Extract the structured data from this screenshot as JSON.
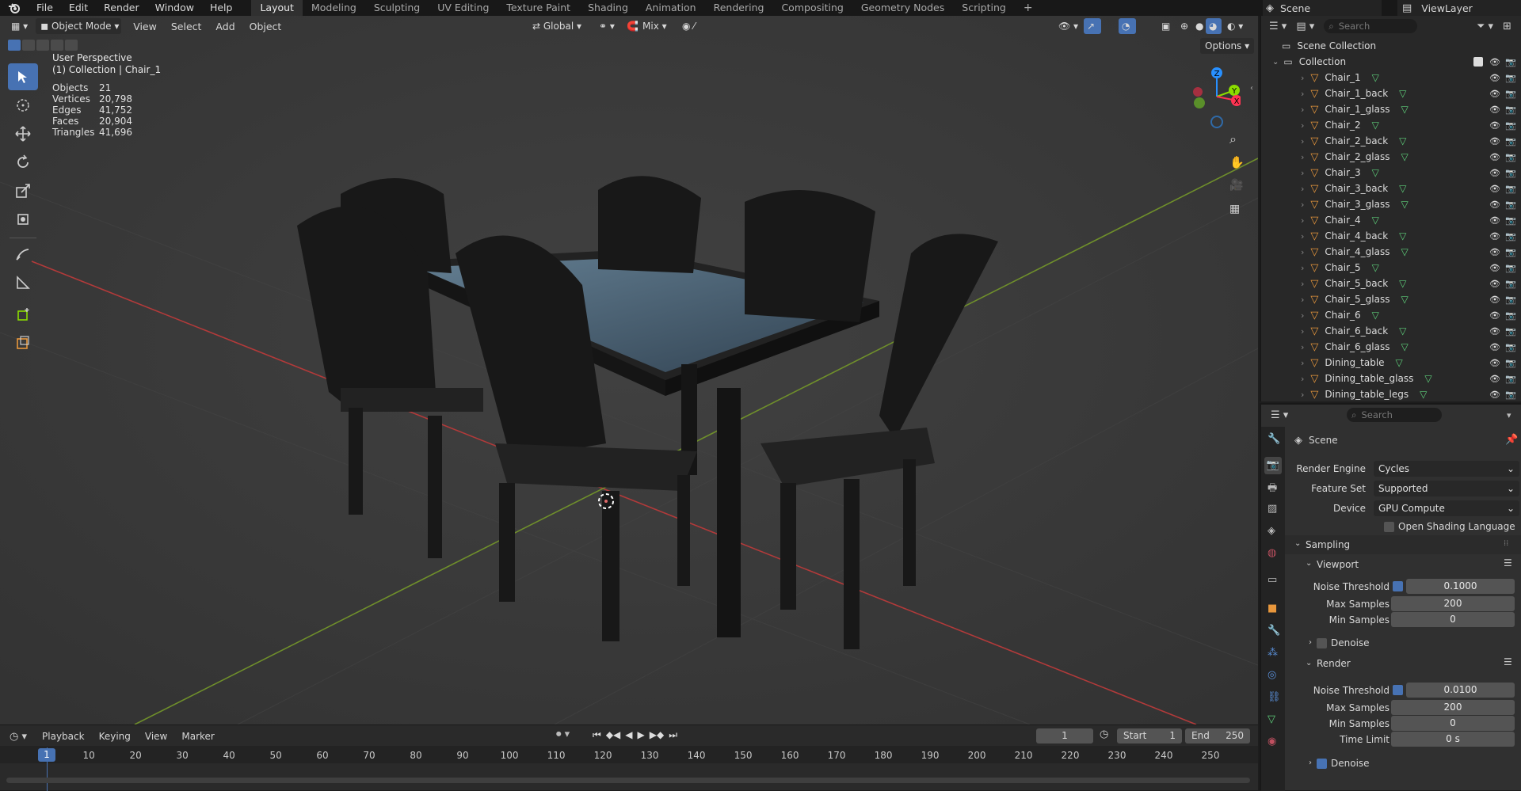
{
  "app": {
    "menu": [
      "File",
      "Edit",
      "Render",
      "Window",
      "Help"
    ],
    "workspaces": [
      "Layout",
      "Modeling",
      "Sculpting",
      "UV Editing",
      "Texture Paint",
      "Shading",
      "Animation",
      "Rendering",
      "Compositing",
      "Geometry Nodes",
      "Scripting"
    ],
    "active_workspace": "Layout",
    "scene_name": "Scene",
    "view_layer": "ViewLayer"
  },
  "viewport": {
    "mode": "Object Mode",
    "menus": [
      "View",
      "Select",
      "Add",
      "Object"
    ],
    "transform_orientation": "Global",
    "snap_mode": "Mix",
    "options_label": "Options",
    "overlay_title": "User Perspective",
    "overlay_subtitle": "(1) Collection | Chair_1",
    "stats": [
      {
        "label": "Objects",
        "value": "21"
      },
      {
        "label": "Vertices",
        "value": "20,798"
      },
      {
        "label": "Edges",
        "value": "41,752"
      },
      {
        "label": "Faces",
        "value": "20,904"
      },
      {
        "label": "Triangles",
        "value": "41,696"
      }
    ],
    "gizmo_axes": [
      "Z",
      "Y",
      "X"
    ]
  },
  "timeline": {
    "menus": [
      "Playback",
      "Keying",
      "View",
      "Marker"
    ],
    "current_frame": "1",
    "start_label": "Start",
    "start_value": "1",
    "end_label": "End",
    "end_value": "250",
    "ticks": [
      "1",
      "10",
      "20",
      "30",
      "40",
      "50",
      "60",
      "70",
      "80",
      "90",
      "100",
      "110",
      "120",
      "130",
      "140",
      "150",
      "160",
      "170",
      "180",
      "190",
      "200",
      "210",
      "220",
      "230",
      "240",
      "250"
    ]
  },
  "outliner": {
    "search_placeholder": "Search",
    "scene_collection": "Scene Collection",
    "collection": "Collection",
    "objects": [
      "Chair_1",
      "Chair_1_back",
      "Chair_1_glass",
      "Chair_2",
      "Chair_2_back",
      "Chair_2_glass",
      "Chair_3",
      "Chair_3_back",
      "Chair_3_glass",
      "Chair_4",
      "Chair_4_back",
      "Chair_4_glass",
      "Chair_5",
      "Chair_5_back",
      "Chair_5_glass",
      "Chair_6",
      "Chair_6_back",
      "Chair_6_glass",
      "Dining_table",
      "Dining_table_glass",
      "Dining_table_legs"
    ]
  },
  "properties": {
    "search_placeholder": "Search",
    "context": "Scene",
    "render_engine_label": "Render Engine",
    "render_engine": "Cycles",
    "feature_set_label": "Feature Set",
    "feature_set": "Supported",
    "device_label": "Device",
    "device": "GPU Compute",
    "osl_label": "Open Shading Language",
    "sampling_label": "Sampling",
    "viewport_label": "Viewport",
    "vp_noise_label": "Noise Threshold",
    "vp_noise": "0.1000",
    "vp_max_label": "Max Samples",
    "vp_max": "200",
    "vp_min_label": "Min Samples",
    "vp_min": "0",
    "vp_denoise_label": "Denoise",
    "render_label": "Render",
    "r_noise_label": "Noise Threshold",
    "r_noise": "0.0100",
    "r_max_label": "Max Samples",
    "r_max": "200",
    "r_min_label": "Min Samples",
    "r_min": "0",
    "r_time_label": "Time Limit",
    "r_time": "0 s",
    "r_denoise_label": "Denoise"
  },
  "colors": {
    "accent": "#4772b3",
    "x_axis": "#ff3352",
    "y_axis": "#8bdc00",
    "z_axis": "#2890ff",
    "mesh_icon": "#e8973c",
    "data_icon": "#5ecf7a"
  }
}
